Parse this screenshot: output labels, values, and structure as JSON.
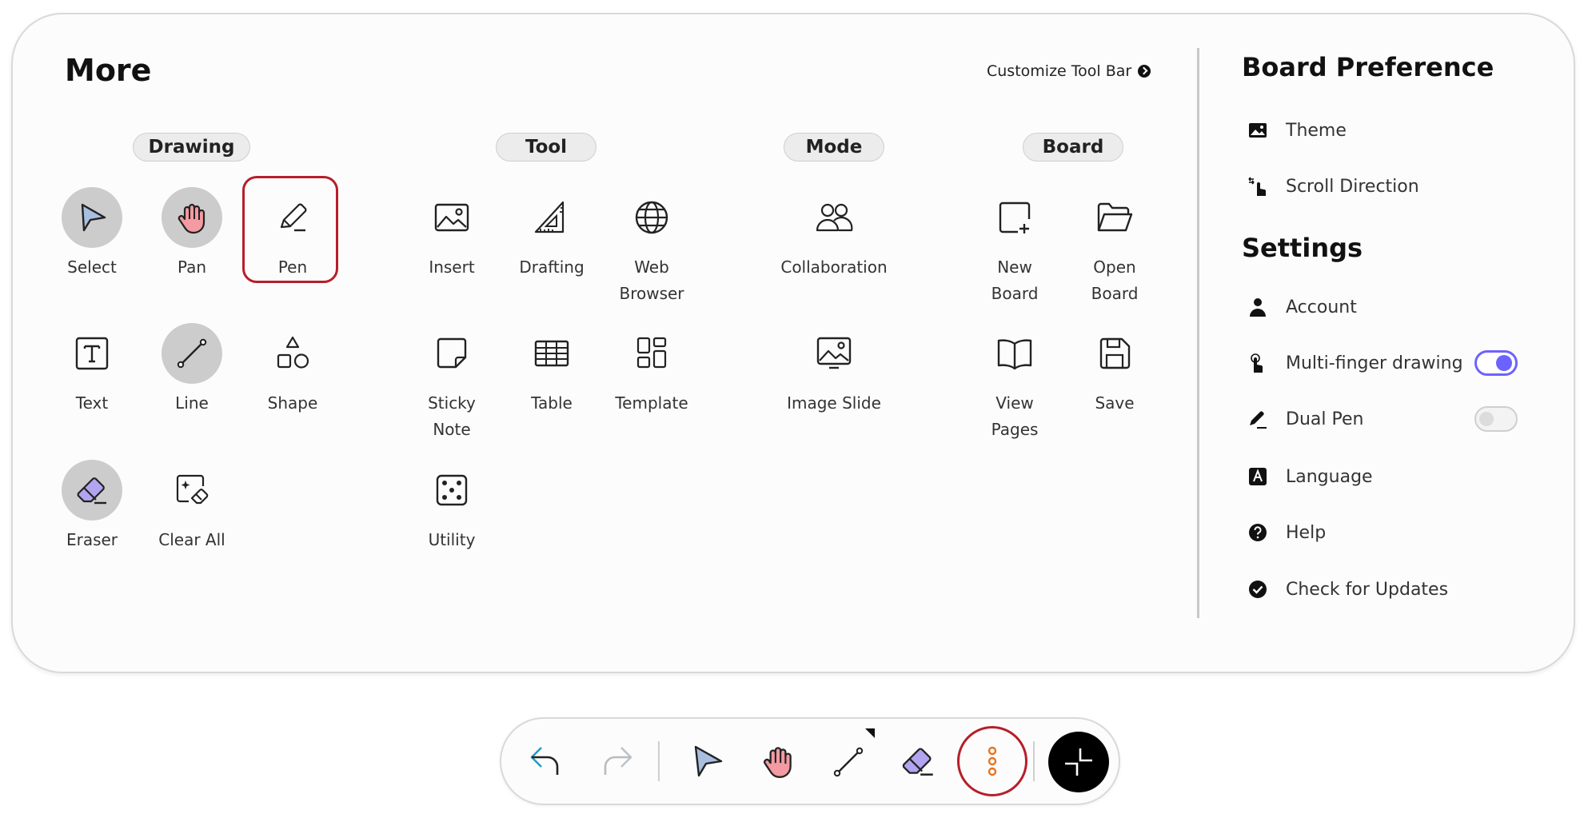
{
  "more": {
    "title": "More",
    "customize_label": "Customize Tool Bar"
  },
  "categories": {
    "drawing": "Drawing",
    "tool": "Tool",
    "mode": "Mode",
    "board": "Board"
  },
  "drawing": {
    "select": "Select",
    "pan": "Pan",
    "pen": "Pen",
    "text": "Text",
    "line": "Line",
    "shape": "Shape",
    "eraser": "Eraser",
    "clear_all": "Clear All"
  },
  "tool": {
    "insert": "Insert",
    "drafting": "Drafting",
    "web_browser": "Web\nBrowser",
    "sticky_note": "Sticky\nNote",
    "table": "Table",
    "template": "Template",
    "utility": "Utility"
  },
  "mode": {
    "collaboration": "Collaboration",
    "image_slide": "Image Slide"
  },
  "board": {
    "new_board": "New\nBoard",
    "open_board": "Open\nBoard",
    "view_pages": "View\nPages",
    "save": "Save"
  },
  "board_preference": {
    "title": "Board Preference",
    "theme": "Theme",
    "scroll_direction": "Scroll Direction"
  },
  "settings": {
    "title": "Settings",
    "account": "Account",
    "multi_finger": "Multi-finger drawing",
    "multi_finger_on": true,
    "dual_pen": "Dual Pen",
    "dual_pen_on": false,
    "language": "Language",
    "help": "Help",
    "check_updates": "Check for Updates"
  },
  "dock": {
    "buttons": [
      "undo-icon",
      "redo-icon",
      "select-icon",
      "pan-hand-icon",
      "line-icon",
      "eraser-icon",
      "more-vertical-icon",
      "collapse-icon"
    ]
  },
  "colors": {
    "selection_outline": "#b51f2a",
    "toggle_accent": "#6c63ff",
    "more_dots": "#e8731e"
  }
}
